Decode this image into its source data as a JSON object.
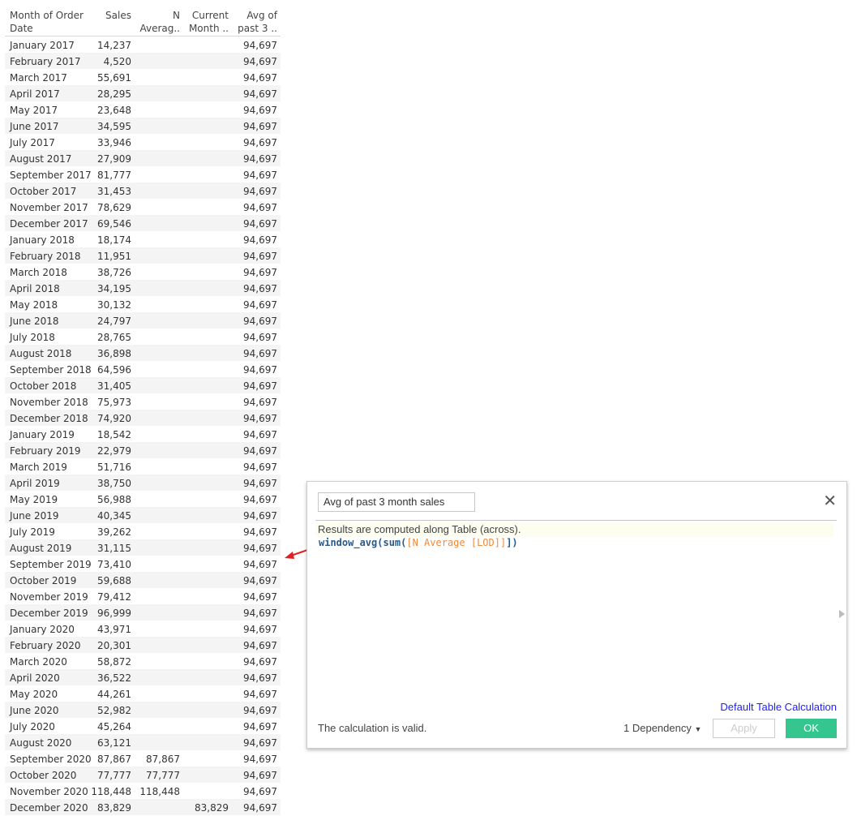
{
  "table": {
    "headers": [
      "Month of Order\nDate",
      "Sales",
      "N\nAverag..",
      "Current\nMonth ..",
      "Avg of\npast 3 .."
    ],
    "rows": [
      [
        "January 2017",
        "14,237",
        "",
        "",
        "94,697"
      ],
      [
        "February 2017",
        "4,520",
        "",
        "",
        "94,697"
      ],
      [
        "March 2017",
        "55,691",
        "",
        "",
        "94,697"
      ],
      [
        "April 2017",
        "28,295",
        "",
        "",
        "94,697"
      ],
      [
        "May 2017",
        "23,648",
        "",
        "",
        "94,697"
      ],
      [
        "June 2017",
        "34,595",
        "",
        "",
        "94,697"
      ],
      [
        "July 2017",
        "33,946",
        "",
        "",
        "94,697"
      ],
      [
        "August 2017",
        "27,909",
        "",
        "",
        "94,697"
      ],
      [
        "September 2017",
        "81,777",
        "",
        "",
        "94,697"
      ],
      [
        "October 2017",
        "31,453",
        "",
        "",
        "94,697"
      ],
      [
        "November 2017",
        "78,629",
        "",
        "",
        "94,697"
      ],
      [
        "December 2017",
        "69,546",
        "",
        "",
        "94,697"
      ],
      [
        "January 2018",
        "18,174",
        "",
        "",
        "94,697"
      ],
      [
        "February 2018",
        "11,951",
        "",
        "",
        "94,697"
      ],
      [
        "March 2018",
        "38,726",
        "",
        "",
        "94,697"
      ],
      [
        "April 2018",
        "34,195",
        "",
        "",
        "94,697"
      ],
      [
        "May 2018",
        "30,132",
        "",
        "",
        "94,697"
      ],
      [
        "June 2018",
        "24,797",
        "",
        "",
        "94,697"
      ],
      [
        "July 2018",
        "28,765",
        "",
        "",
        "94,697"
      ],
      [
        "August 2018",
        "36,898",
        "",
        "",
        "94,697"
      ],
      [
        "September 2018",
        "64,596",
        "",
        "",
        "94,697"
      ],
      [
        "October 2018",
        "31,405",
        "",
        "",
        "94,697"
      ],
      [
        "November 2018",
        "75,973",
        "",
        "",
        "94,697"
      ],
      [
        "December 2018",
        "74,920",
        "",
        "",
        "94,697"
      ],
      [
        "January 2019",
        "18,542",
        "",
        "",
        "94,697"
      ],
      [
        "February 2019",
        "22,979",
        "",
        "",
        "94,697"
      ],
      [
        "March 2019",
        "51,716",
        "",
        "",
        "94,697"
      ],
      [
        "April 2019",
        "38,750",
        "",
        "",
        "94,697"
      ],
      [
        "May 2019",
        "56,988",
        "",
        "",
        "94,697"
      ],
      [
        "June 2019",
        "40,345",
        "",
        "",
        "94,697"
      ],
      [
        "July 2019",
        "39,262",
        "",
        "",
        "94,697"
      ],
      [
        "August 2019",
        "31,115",
        "",
        "",
        "94,697"
      ],
      [
        "September 2019",
        "73,410",
        "",
        "",
        "94,697"
      ],
      [
        "October 2019",
        "59,688",
        "",
        "",
        "94,697"
      ],
      [
        "November 2019",
        "79,412",
        "",
        "",
        "94,697"
      ],
      [
        "December 2019",
        "96,999",
        "",
        "",
        "94,697"
      ],
      [
        "January 2020",
        "43,971",
        "",
        "",
        "94,697"
      ],
      [
        "February 2020",
        "20,301",
        "",
        "",
        "94,697"
      ],
      [
        "March 2020",
        "58,872",
        "",
        "",
        "94,697"
      ],
      [
        "April 2020",
        "36,522",
        "",
        "",
        "94,697"
      ],
      [
        "May 2020",
        "44,261",
        "",
        "",
        "94,697"
      ],
      [
        "June 2020",
        "52,982",
        "",
        "",
        "94,697"
      ],
      [
        "July 2020",
        "45,264",
        "",
        "",
        "94,697"
      ],
      [
        "August 2020",
        "63,121",
        "",
        "",
        "94,697"
      ],
      [
        "September 2020",
        "87,867",
        "87,867",
        "",
        "94,697"
      ],
      [
        "October 2020",
        "77,777",
        "77,777",
        "",
        "94,697"
      ],
      [
        "November 2020",
        "118,448",
        "118,448",
        "",
        "94,697"
      ],
      [
        "December 2020",
        "83,829",
        "",
        "83,829",
        "94,697"
      ]
    ]
  },
  "dialog": {
    "name": "Avg of past 3 month sales",
    "info": "Results are computed along Table (across).",
    "code_fn": "window_avg(sum(",
    "code_field": "[N Average [LOD]]",
    "code_end": "])",
    "default_table_calc": "Default Table Calculation",
    "status": "The calculation is valid.",
    "dependency": "1 Dependency",
    "apply": "Apply",
    "ok": "OK"
  },
  "colors": {
    "ok": "#35c690",
    "arrow": "#e02020",
    "link": "#2222ee"
  }
}
